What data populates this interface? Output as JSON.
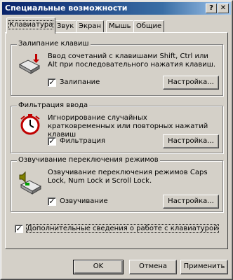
{
  "window": {
    "title": "Специальные возможности",
    "help_btn": "?",
    "close_btn": "✕"
  },
  "tabs": [
    {
      "label": "Клавиатура",
      "active": true
    },
    {
      "label": "Звук"
    },
    {
      "label": "Экран"
    },
    {
      "label": "Мышь"
    },
    {
      "label": "Общие"
    }
  ],
  "groups": {
    "sticky": {
      "label": "Залипание клавиш",
      "desc": "Ввод сочетаний с клавишами Shift, Ctrl или Alt при последовательного нажатия клавиш.",
      "checkbox_label": "Залипание",
      "checked": true,
      "button": "Настройка..."
    },
    "filter": {
      "label": "Фильтрация ввода",
      "desc": "Игнорирование случайных кратковременных или повторных нажатий клавиш",
      "checkbox_label": "Фильтрация",
      "checked": true,
      "button": "Настройка..."
    },
    "toggle": {
      "label": "Озвучивание переключения режимов",
      "desc": "Озвучивание переключения режимов Caps Lock, Num Lock и Scroll Lock.",
      "checkbox_label": "Озвучивание",
      "checked": true,
      "button": "Настройка..."
    }
  },
  "extra": {
    "label": "Дополнительные сведения о работе с клавиатурой",
    "checked": true
  },
  "footer": {
    "ok": "OK",
    "cancel": "Отмена",
    "apply": "Применить"
  },
  "check_glyph": "✓"
}
